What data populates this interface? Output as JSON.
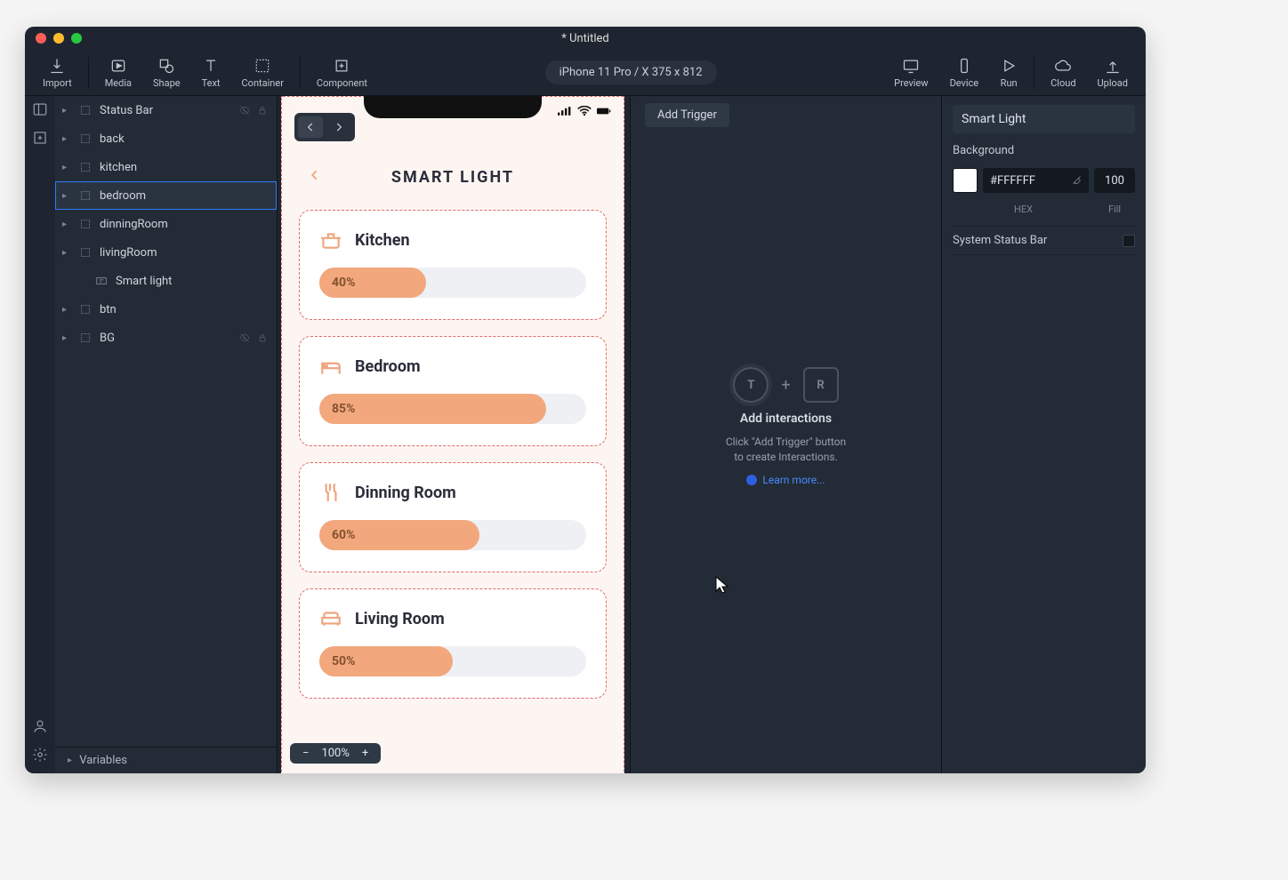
{
  "window": {
    "title": "* Untitled"
  },
  "toolbar": {
    "import": "Import",
    "media": "Media",
    "shape": "Shape",
    "text": "Text",
    "container": "Container",
    "component": "Component",
    "device_label": "iPhone 11 Pro / X  375 x 812",
    "preview": "Preview",
    "device": "Device",
    "run": "Run",
    "cloud": "Cloud",
    "upload": "Upload"
  },
  "layers": {
    "items": [
      {
        "label": "Status Bar",
        "depth": 0,
        "type": "group",
        "hidden": true,
        "locked": true
      },
      {
        "label": "back",
        "depth": 0,
        "type": "group"
      },
      {
        "label": "kitchen",
        "depth": 0,
        "type": "group"
      },
      {
        "label": "bedroom",
        "depth": 0,
        "type": "group",
        "selected": true
      },
      {
        "label": "dinningRoom",
        "depth": 0,
        "type": "group"
      },
      {
        "label": "livingRoom",
        "depth": 0,
        "type": "group"
      },
      {
        "label": "Smart light",
        "depth": 1,
        "type": "text",
        "noChevron": true
      },
      {
        "label": "btn",
        "depth": 0,
        "type": "group"
      },
      {
        "label": "BG",
        "depth": 0,
        "type": "group",
        "hidden": true,
        "locked": true
      }
    ],
    "footer": "Variables"
  },
  "canvas": {
    "nav_back": "<",
    "nav_fwd": ">",
    "title": "SMART LIGHT",
    "rooms": [
      {
        "name": "Kitchen",
        "percent": 40,
        "label": "40%",
        "icon": "pot"
      },
      {
        "name": "Bedroom",
        "percent": 85,
        "label": "85%",
        "icon": "bed"
      },
      {
        "name": "Dinning Room",
        "percent": 60,
        "label": "60%",
        "icon": "fork"
      },
      {
        "name": "Living Room",
        "percent": 50,
        "label": "50%",
        "icon": "sofa"
      }
    ],
    "zoom": {
      "minus": "−",
      "value": "100%",
      "plus": "+"
    }
  },
  "interactions": {
    "add_trigger": "Add Trigger",
    "t": "T",
    "r": "R",
    "heading": "Add interactions",
    "sub1": "Click \"Add Trigger\" button",
    "sub2": "to create Interactions.",
    "learn": "Learn more..."
  },
  "inspector": {
    "selection": "Smart Light",
    "bg_label": "Background",
    "hex": "#FFFFFF",
    "fill": "100",
    "hex_caption": "HEX",
    "fill_caption": "Fill",
    "system_status": "System Status Bar"
  }
}
